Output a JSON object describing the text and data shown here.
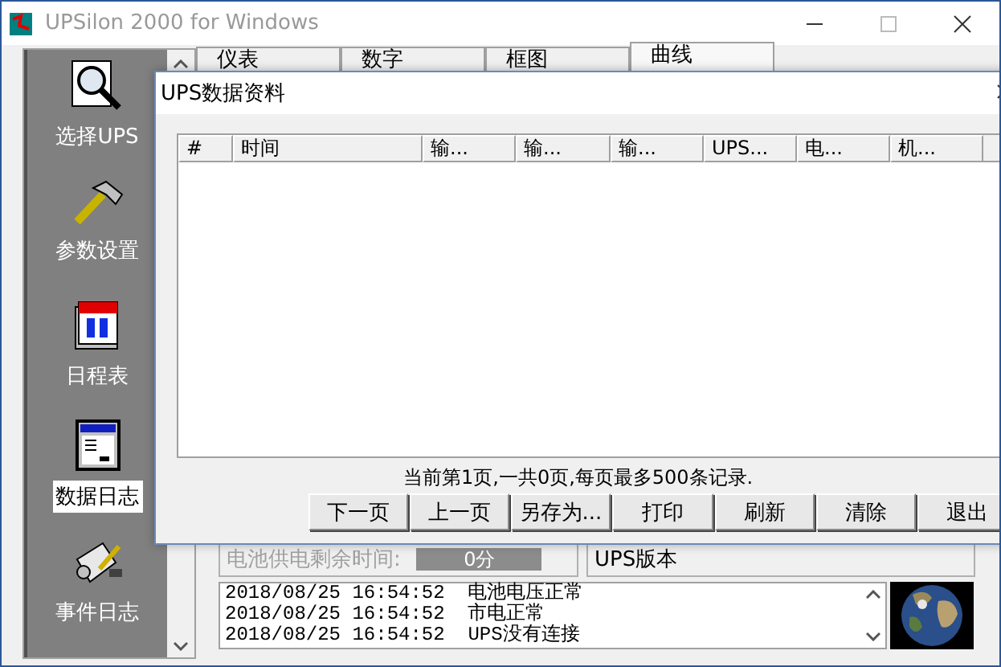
{
  "window": {
    "title": "UPSilon 2000 for Windows"
  },
  "sidebar": {
    "items": [
      {
        "label": "选择UPS",
        "kind": "search",
        "selected": false
      },
      {
        "label": "参数设置",
        "kind": "hammer",
        "selected": false
      },
      {
        "label": "日程表",
        "kind": "calendar",
        "selected": false
      },
      {
        "label": "数据日志",
        "kind": "document",
        "selected": true
      },
      {
        "label": "事件日志",
        "kind": "scroll",
        "selected": false
      }
    ]
  },
  "tabs": [
    {
      "label": "仪表",
      "selected": false
    },
    {
      "label": "数字",
      "selected": false
    },
    {
      "label": "框图",
      "selected": false
    },
    {
      "label": "曲线",
      "selected": true
    }
  ],
  "status": {
    "battery": {
      "label": "电池供电剩余时间:",
      "value": "0分",
      "disabled": true
    },
    "ups_version": "UPS版本"
  },
  "log": [
    {
      "time": "2018/08/25 16:54:52",
      "message": "电池电压正常"
    },
    {
      "time": "2018/08/25 16:54:52",
      "message": "市电正常"
    },
    {
      "time": "2018/08/25 16:54:52",
      "message": "UPS没有连接"
    }
  ],
  "dialog": {
    "title": "UPS数据资料",
    "table": {
      "columns": [
        "#",
        "时间",
        "输...",
        "输...",
        "输...",
        "UPS...",
        "电...",
        "机..."
      ]
    },
    "page_info": "当前第1页,一共0页,每页最多500条记录.",
    "buttons": [
      "下一页",
      "上一页",
      "另存为...",
      "打印",
      "刷新",
      "清除",
      "退出"
    ]
  }
}
